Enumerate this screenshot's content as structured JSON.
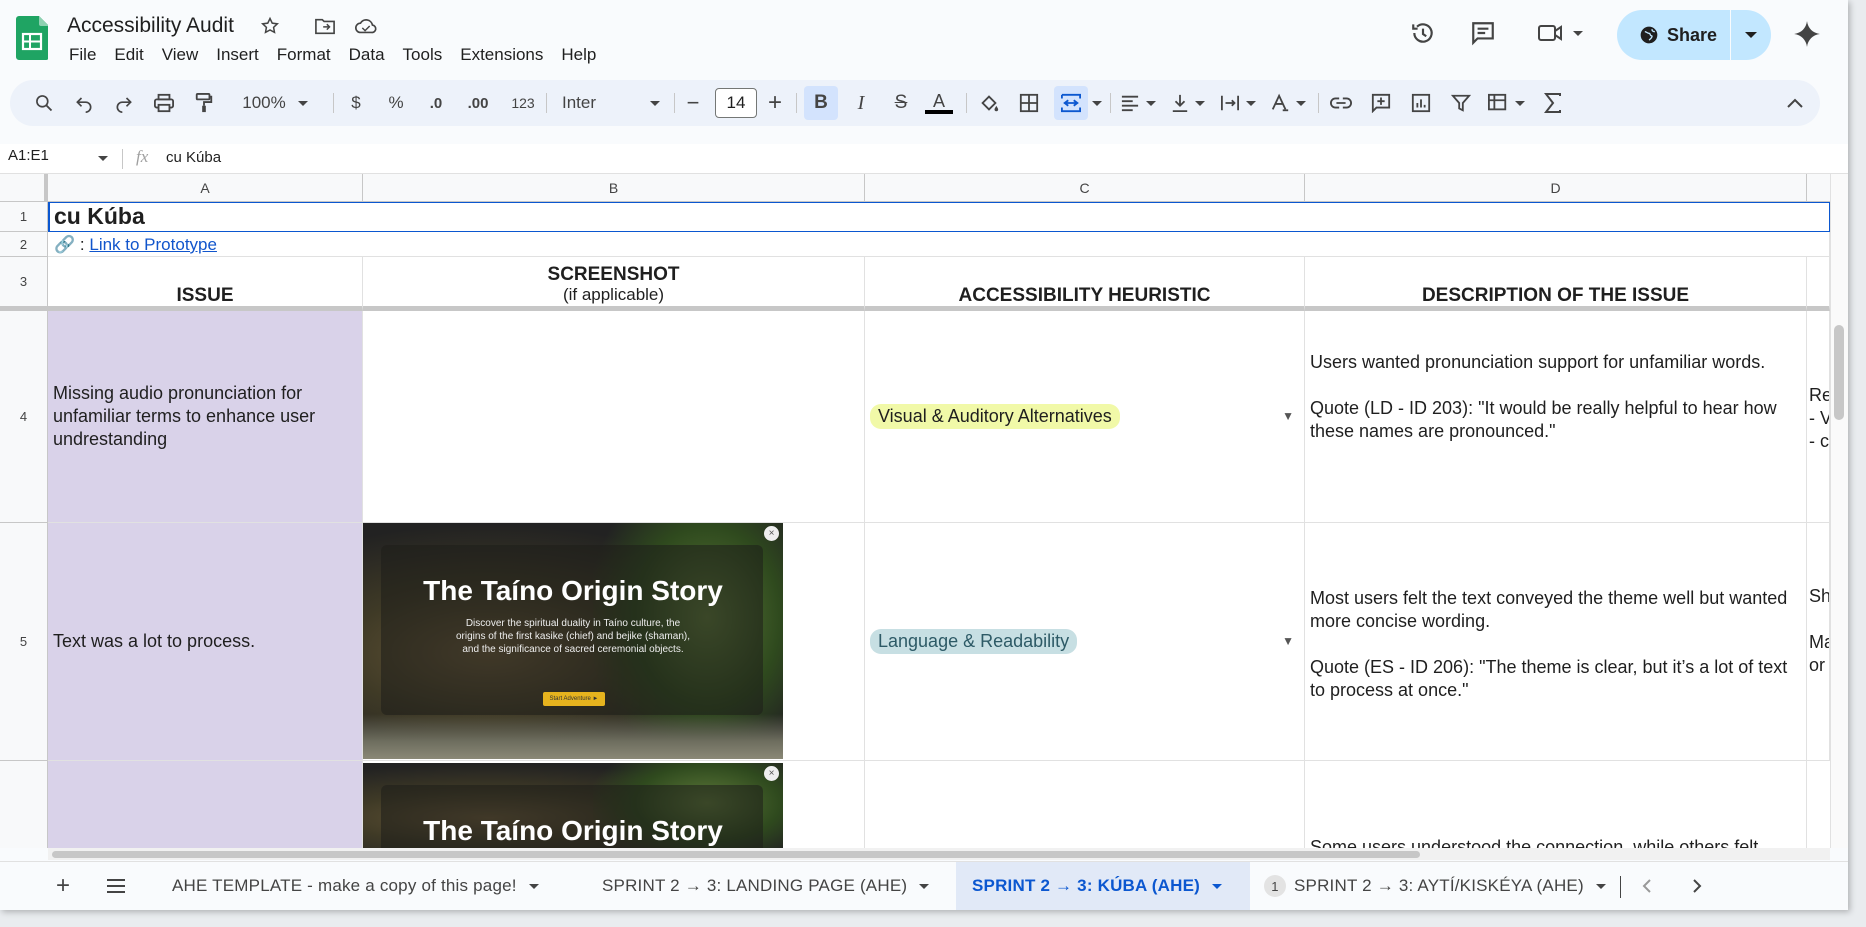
{
  "doc": {
    "title": "Accessibility Audit"
  },
  "menu": [
    "File",
    "Edit",
    "View",
    "Insert",
    "Format",
    "Data",
    "Tools",
    "Extensions",
    "Help"
  ],
  "share": {
    "label": "Share"
  },
  "toolbar": {
    "zoom": "100%",
    "currency": "$",
    "percent": "%",
    "dec_decrease": ".0",
    "dec_increase": ".00",
    "number_format": "123",
    "font": "Inter",
    "font_size": "14",
    "minus": "−",
    "plus": "+",
    "bold": "B",
    "italic": "I",
    "strike": "S",
    "text_color": "A"
  },
  "formula_bar": {
    "name_box": "A1:E1",
    "fx": "fx",
    "value": "cu Kúba"
  },
  "columns": [
    "A",
    "B",
    "C",
    "D"
  ],
  "rows": [
    "1",
    "2",
    "3",
    "4",
    "5"
  ],
  "sheet": {
    "title": "cu Kúba",
    "link_prefix": ":",
    "link_text": "Link to Prototype",
    "headers": {
      "issue": "ISSUE",
      "screenshot": "SCREENSHOT",
      "screenshot_sub": "(if applicable)",
      "heuristic": "ACCESSIBILITY HEURISTIC",
      "description": "DESCRIPTION OF THE ISSUE"
    },
    "rows": [
      {
        "issue": "Missing audio pronunciation for unfamiliar terms to enhance user undrestanding",
        "heuristic": "Visual & Auditory Alternatives",
        "desc_1": "Users wanted pronunciation support for unfamiliar words.",
        "desc_2": "Quote (LD - ID 203): \"It would be really helpful to hear how these names are pronounced.\"",
        "col_e": "Re\n- V\n- c"
      },
      {
        "issue": "Text was a lot to process.",
        "heuristic": "Language & Readability",
        "desc_1": "Most users felt the text conveyed the theme well but wanted more concise wording.",
        "desc_2": "Quote (ES - ID 206): \"The theme is clear, but it’s a lot of text to process at once.\"",
        "col_e": "Sh\n\nMa\nor"
      },
      {
        "desc_1": "Some users understood the connection, while others felt"
      }
    ],
    "screenshot": {
      "title": "The Taíno Origin Story",
      "subtitle": "Discover the spiritual duality in Taíno culture, the origins of the first kasike (chief) and bejike (shaman), and the significance of sacred ceremonial objects.",
      "button": "Start Adventure ►"
    }
  },
  "tabs": [
    {
      "label": "AHE TEMPLATE - make a copy of this page!"
    },
    {
      "label": "SPRINT 2 → 3: LANDING PAGE (AHE)"
    },
    {
      "label": "SPRINT 2 → 3: KÚBA (AHE)",
      "active": true
    },
    {
      "label": "SPRINT 2 → 3: AYTÍ/KISKÉYA (AHE)",
      "badge": "1"
    }
  ],
  "colors": {
    "purple_cell": "#d9d2e9",
    "chip_visual": "#f1f9a8",
    "chip_language": "#c7dfe3",
    "accent": "#0b57d0",
    "share_bg": "#c2e7ff"
  }
}
